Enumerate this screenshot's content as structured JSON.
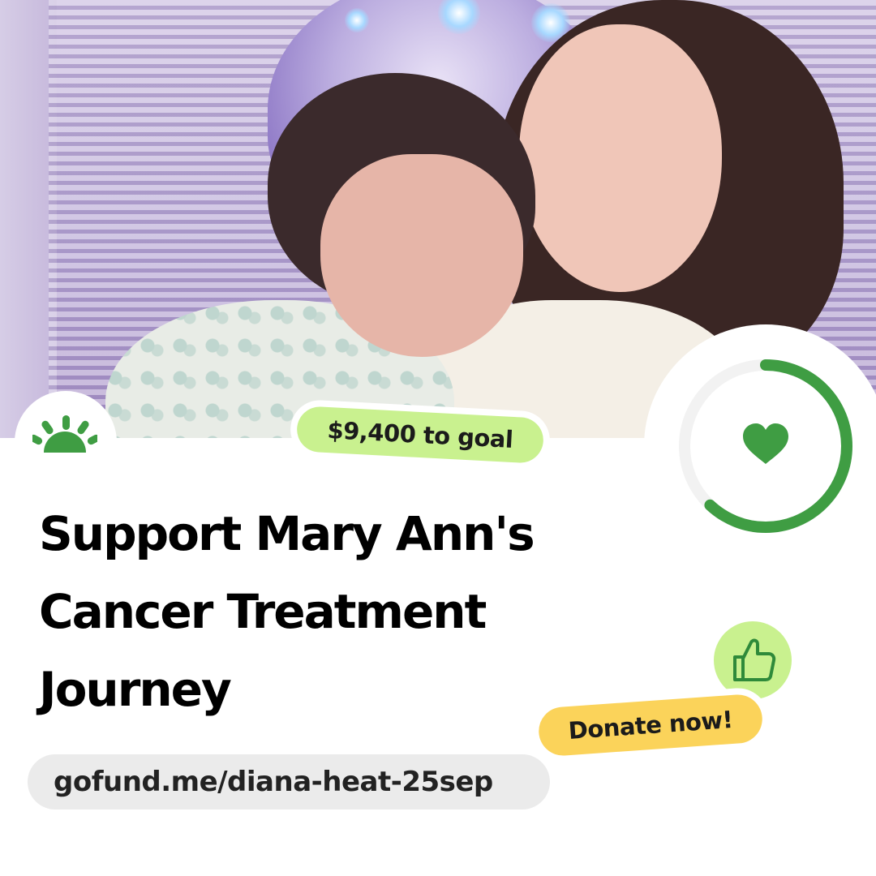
{
  "photo": {
    "description_icon": "photo"
  },
  "brand": {
    "logo_icon": "gofundme-sunrise-icon",
    "accent_color": "#3f9d43"
  },
  "goal_tag": {
    "label": "$9,400 to goal",
    "color": "#c9f18f"
  },
  "campaign": {
    "title": "Support Mary Ann's Cancer Treatment Journey",
    "url": "gofund.me/diana-heat-25sep"
  },
  "progress": {
    "fraction": 0.62,
    "icon": "heart-icon",
    "color": "#3f9d43",
    "track_color": "#f2f2f2"
  },
  "cta": {
    "label": "Donate now!",
    "icon": "thumbs-up-icon",
    "color": "#fbd35a"
  }
}
